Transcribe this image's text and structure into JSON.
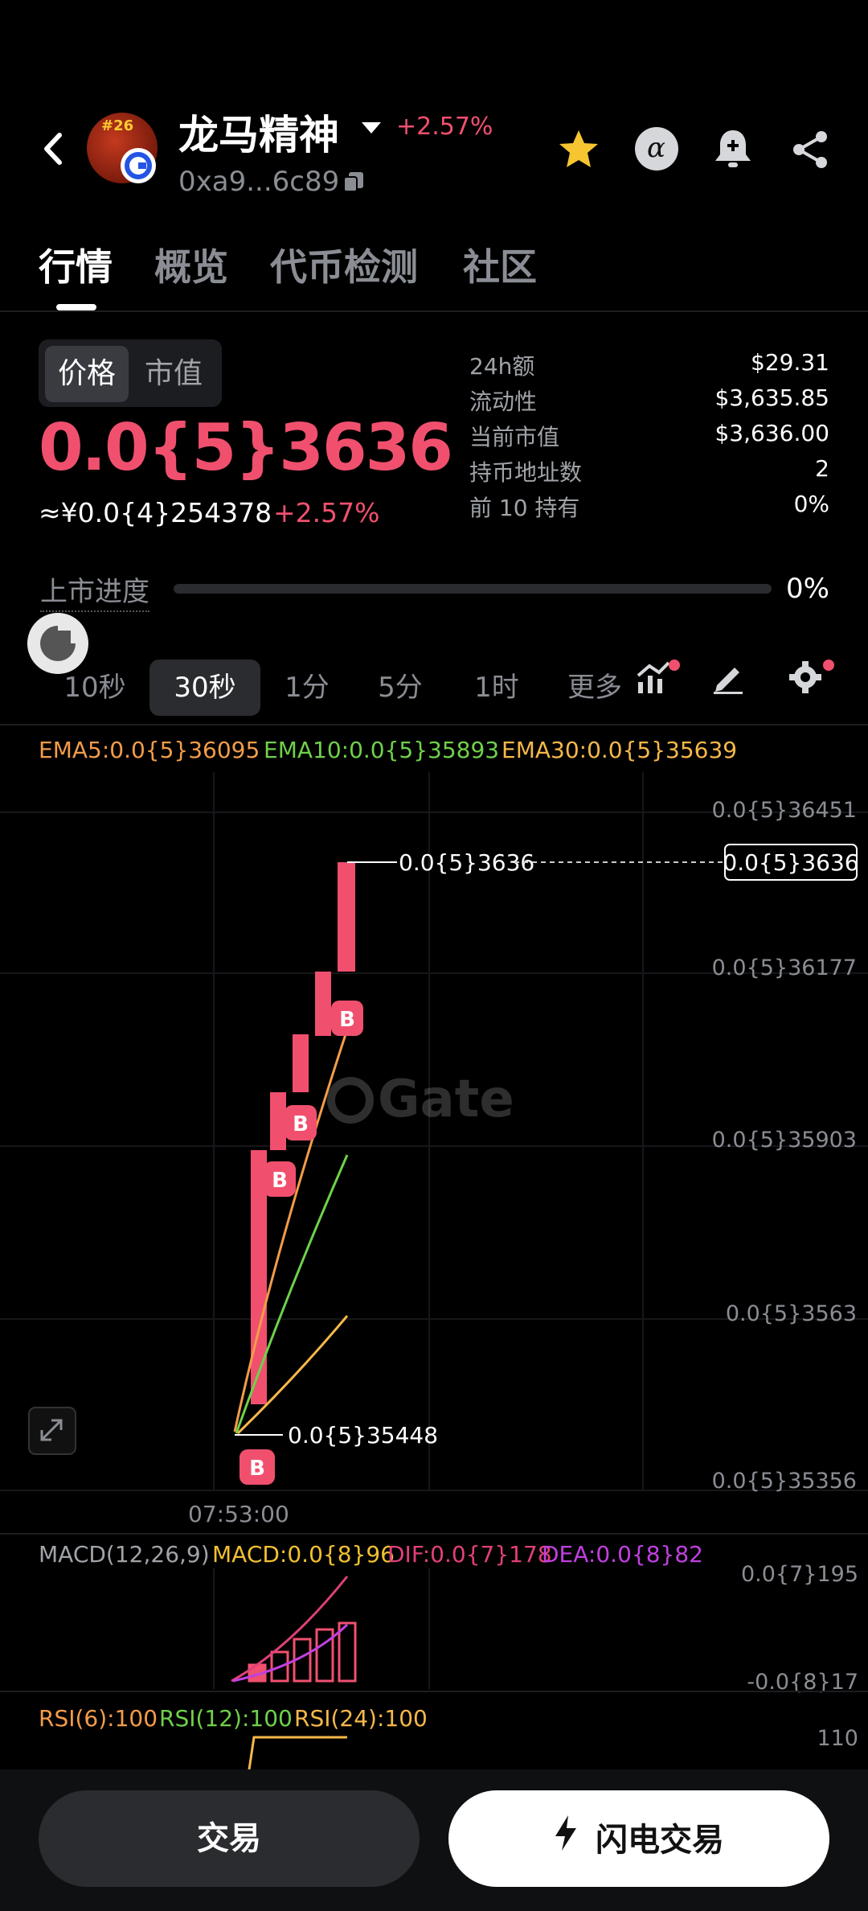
{
  "header": {
    "title": "龙马精神",
    "change": "+2.57%",
    "address": "0xa9...6c89",
    "avatar_badge": "#26"
  },
  "tabs": [
    "行情",
    "概览",
    "代币检测",
    "社区"
  ],
  "price_panel": {
    "toggle": [
      "价格",
      "市值"
    ],
    "price": "0.0{5}3636",
    "cny": "≈¥0.0{4}254378",
    "change": "+2.57%"
  },
  "stats": [
    {
      "label": "24h额",
      "value": "$29.31"
    },
    {
      "label": "流动性",
      "value": "$3,635.85"
    },
    {
      "label": "当前市值",
      "value": "$3,636.00"
    },
    {
      "label": "持币地址数",
      "value": "2"
    },
    {
      "label": "前 10 持有",
      "value": "0%"
    }
  ],
  "progress": {
    "label": "上市进度",
    "value": "0%",
    "fraction": 0.0
  },
  "intervals": [
    "10秒",
    "30秒",
    "1分",
    "5分",
    "1时",
    "更多"
  ],
  "active_interval": 1,
  "ema": {
    "ema5": "EMA5:0.0{5}36095",
    "ema10": "EMA10:0.0{5}35893",
    "ema30": "EMA30:0.0{5}35639"
  },
  "colors": {
    "up": "#f0506e",
    "ema5": "#f39c49",
    "ema10": "#6fd14a",
    "ema30": "#f6b84a",
    "macd": "#f0c030",
    "dif": "#e0407a",
    "dea": "#c040e0"
  },
  "chart_data": {
    "type": "candlestick",
    "y_ticks": [
      "0.0{5}36451",
      "0.0{5}36177",
      "0.0{5}35903",
      "0.0{5}3563",
      "0.0{5}35356"
    ],
    "current_price_label": "0.0{5}3636",
    "high_label": "0.0{5}3636",
    "low_label": "0.0{5}35448",
    "x_tick": "07:53:00",
    "watermark": "Gate",
    "buy_marker": "B"
  },
  "macd": {
    "title": "MACD(12,26,9)",
    "macd": "MACD:0.0{8}96",
    "dif": "DIF:0.0{7}178",
    "dea": "DEA:0.0{8}82",
    "y_top": "0.0{7}195",
    "y_bottom": "-0.0{8}17"
  },
  "rsi": {
    "rsi6": "RSI(6):100",
    "rsi12": "RSI(12):100",
    "rsi24": "RSI(24):100",
    "y_top": "110"
  },
  "actions": {
    "trade": "交易",
    "flash": "闪电交易"
  }
}
